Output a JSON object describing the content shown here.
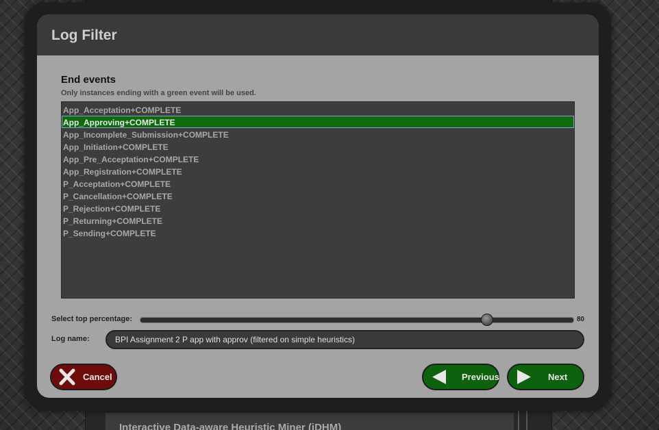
{
  "background": {
    "window_title": "Interactive Data-aware Heuristic Miner (iDHM)"
  },
  "dialog": {
    "title": "Log Filter",
    "section_title": "End events",
    "section_subtitle": "Only instances ending with a green event will be used.",
    "events": [
      {
        "label": "App_Acceptation+COMPLETE",
        "selected": false
      },
      {
        "label": "App_Approving+COMPLETE",
        "selected": true
      },
      {
        "label": "App_Incomplete_Submission+COMPLETE",
        "selected": false
      },
      {
        "label": "App_Initiation+COMPLETE",
        "selected": false
      },
      {
        "label": "App_Pre_Acceptation+COMPLETE",
        "selected": false
      },
      {
        "label": "App_Registration+COMPLETE",
        "selected": false
      },
      {
        "label": "P_Acceptation+COMPLETE",
        "selected": false
      },
      {
        "label": "P_Cancellation+COMPLETE",
        "selected": false
      },
      {
        "label": "P_Rejection+COMPLETE",
        "selected": false
      },
      {
        "label": "P_Returning+COMPLETE",
        "selected": false
      },
      {
        "label": "P_Sending+COMPLETE",
        "selected": false
      }
    ],
    "slider": {
      "label": "Select top percentage:",
      "value": 80,
      "value_text": "80",
      "min": 0,
      "max": 100
    },
    "log_name": {
      "label": "Log name:",
      "value": "BPI Assignment 2 P app with approv (filtered on simple heuristics)"
    },
    "buttons": {
      "cancel_label": "Cancel",
      "previous_label": "Previous",
      "next_label": "Next"
    }
  },
  "colors": {
    "selected_event": "#0f6a0f",
    "cancel_button": "#6e0c0c",
    "nav_button": "#0e620e"
  },
  "icons": {
    "cancel": "close-x-icon",
    "previous": "arrow-left-icon",
    "next": "arrow-right-icon"
  }
}
